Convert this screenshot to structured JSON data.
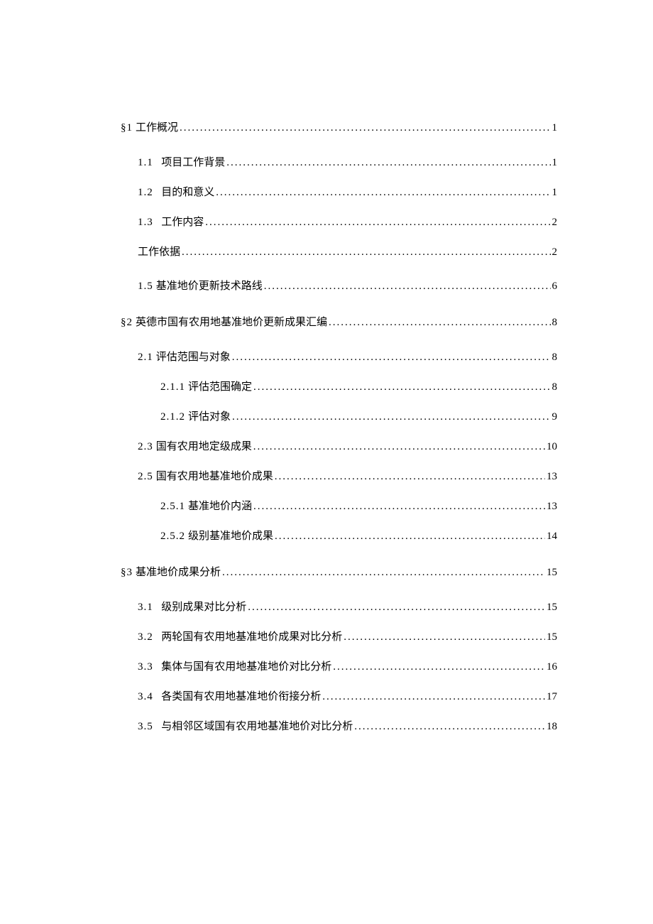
{
  "toc": [
    {
      "level": 1,
      "num": "§1",
      "title": "工作概况",
      "page": "1"
    },
    {
      "level": 2,
      "num": "1.1",
      "title": "项目工作背景",
      "page": "1",
      "numgap": true
    },
    {
      "level": 2,
      "num": "1.2",
      "title": "目的和意义",
      "page": "1",
      "numgap": true
    },
    {
      "level": 2,
      "num": "1.3",
      "title": "工作内容",
      "page": "2",
      "numgap": true
    },
    {
      "level": 2,
      "num": "",
      "title": "工作依据",
      "page": "2"
    },
    {
      "level": 2,
      "num": "1.5",
      "title": "基准地价更新技术路线",
      "page": "6",
      "groupend": true,
      "pretop": true
    },
    {
      "level": 1,
      "num": "§2",
      "title": "英德市国有农用地基准地价更新成果汇编",
      "page": "8"
    },
    {
      "level": 2,
      "num": "2.1",
      "title": "评估范围与对象",
      "page": "8"
    },
    {
      "level": 3,
      "num": "2.1.1",
      "title": "评估范围确定",
      "page": "8"
    },
    {
      "level": 3,
      "num": "2.1.2",
      "title": "评估对象",
      "page": "9"
    },
    {
      "level": 2,
      "num": "2.3",
      "title": "国有农用地定级成果",
      "page": "10"
    },
    {
      "level": 2,
      "num": "2.5",
      "title": "国有农用地基准地价成果",
      "page": "13"
    },
    {
      "level": 3,
      "num": "2.5.1",
      "title": "基准地价内涵",
      "page": "13"
    },
    {
      "level": 3,
      "num": "2.5.2",
      "title": "级别基准地价成果",
      "page": "14",
      "groupend": true
    },
    {
      "level": 1,
      "num": "§3",
      "title": "基准地价成果分析",
      "page": "15"
    },
    {
      "level": 2,
      "num": "3.1",
      "title": "级别成果对比分析",
      "page": "15",
      "numgap": true
    },
    {
      "level": 2,
      "num": "3.2",
      "title": "两轮国有农用地基准地价成果对比分析",
      "page": "15",
      "numgap": true
    },
    {
      "level": 2,
      "num": "3.3",
      "title": "集体与国有农用地基准地价对比分析",
      "page": "16",
      "numgap": true
    },
    {
      "level": 2,
      "num": "3.4",
      "title": "各类国有农用地基准地价衔接分析",
      "page": "17",
      "numgap": true
    },
    {
      "level": 2,
      "num": "3.5",
      "title": "与相邻区域国有农用地基准地价对比分析",
      "page": "18",
      "numgap": true
    }
  ]
}
